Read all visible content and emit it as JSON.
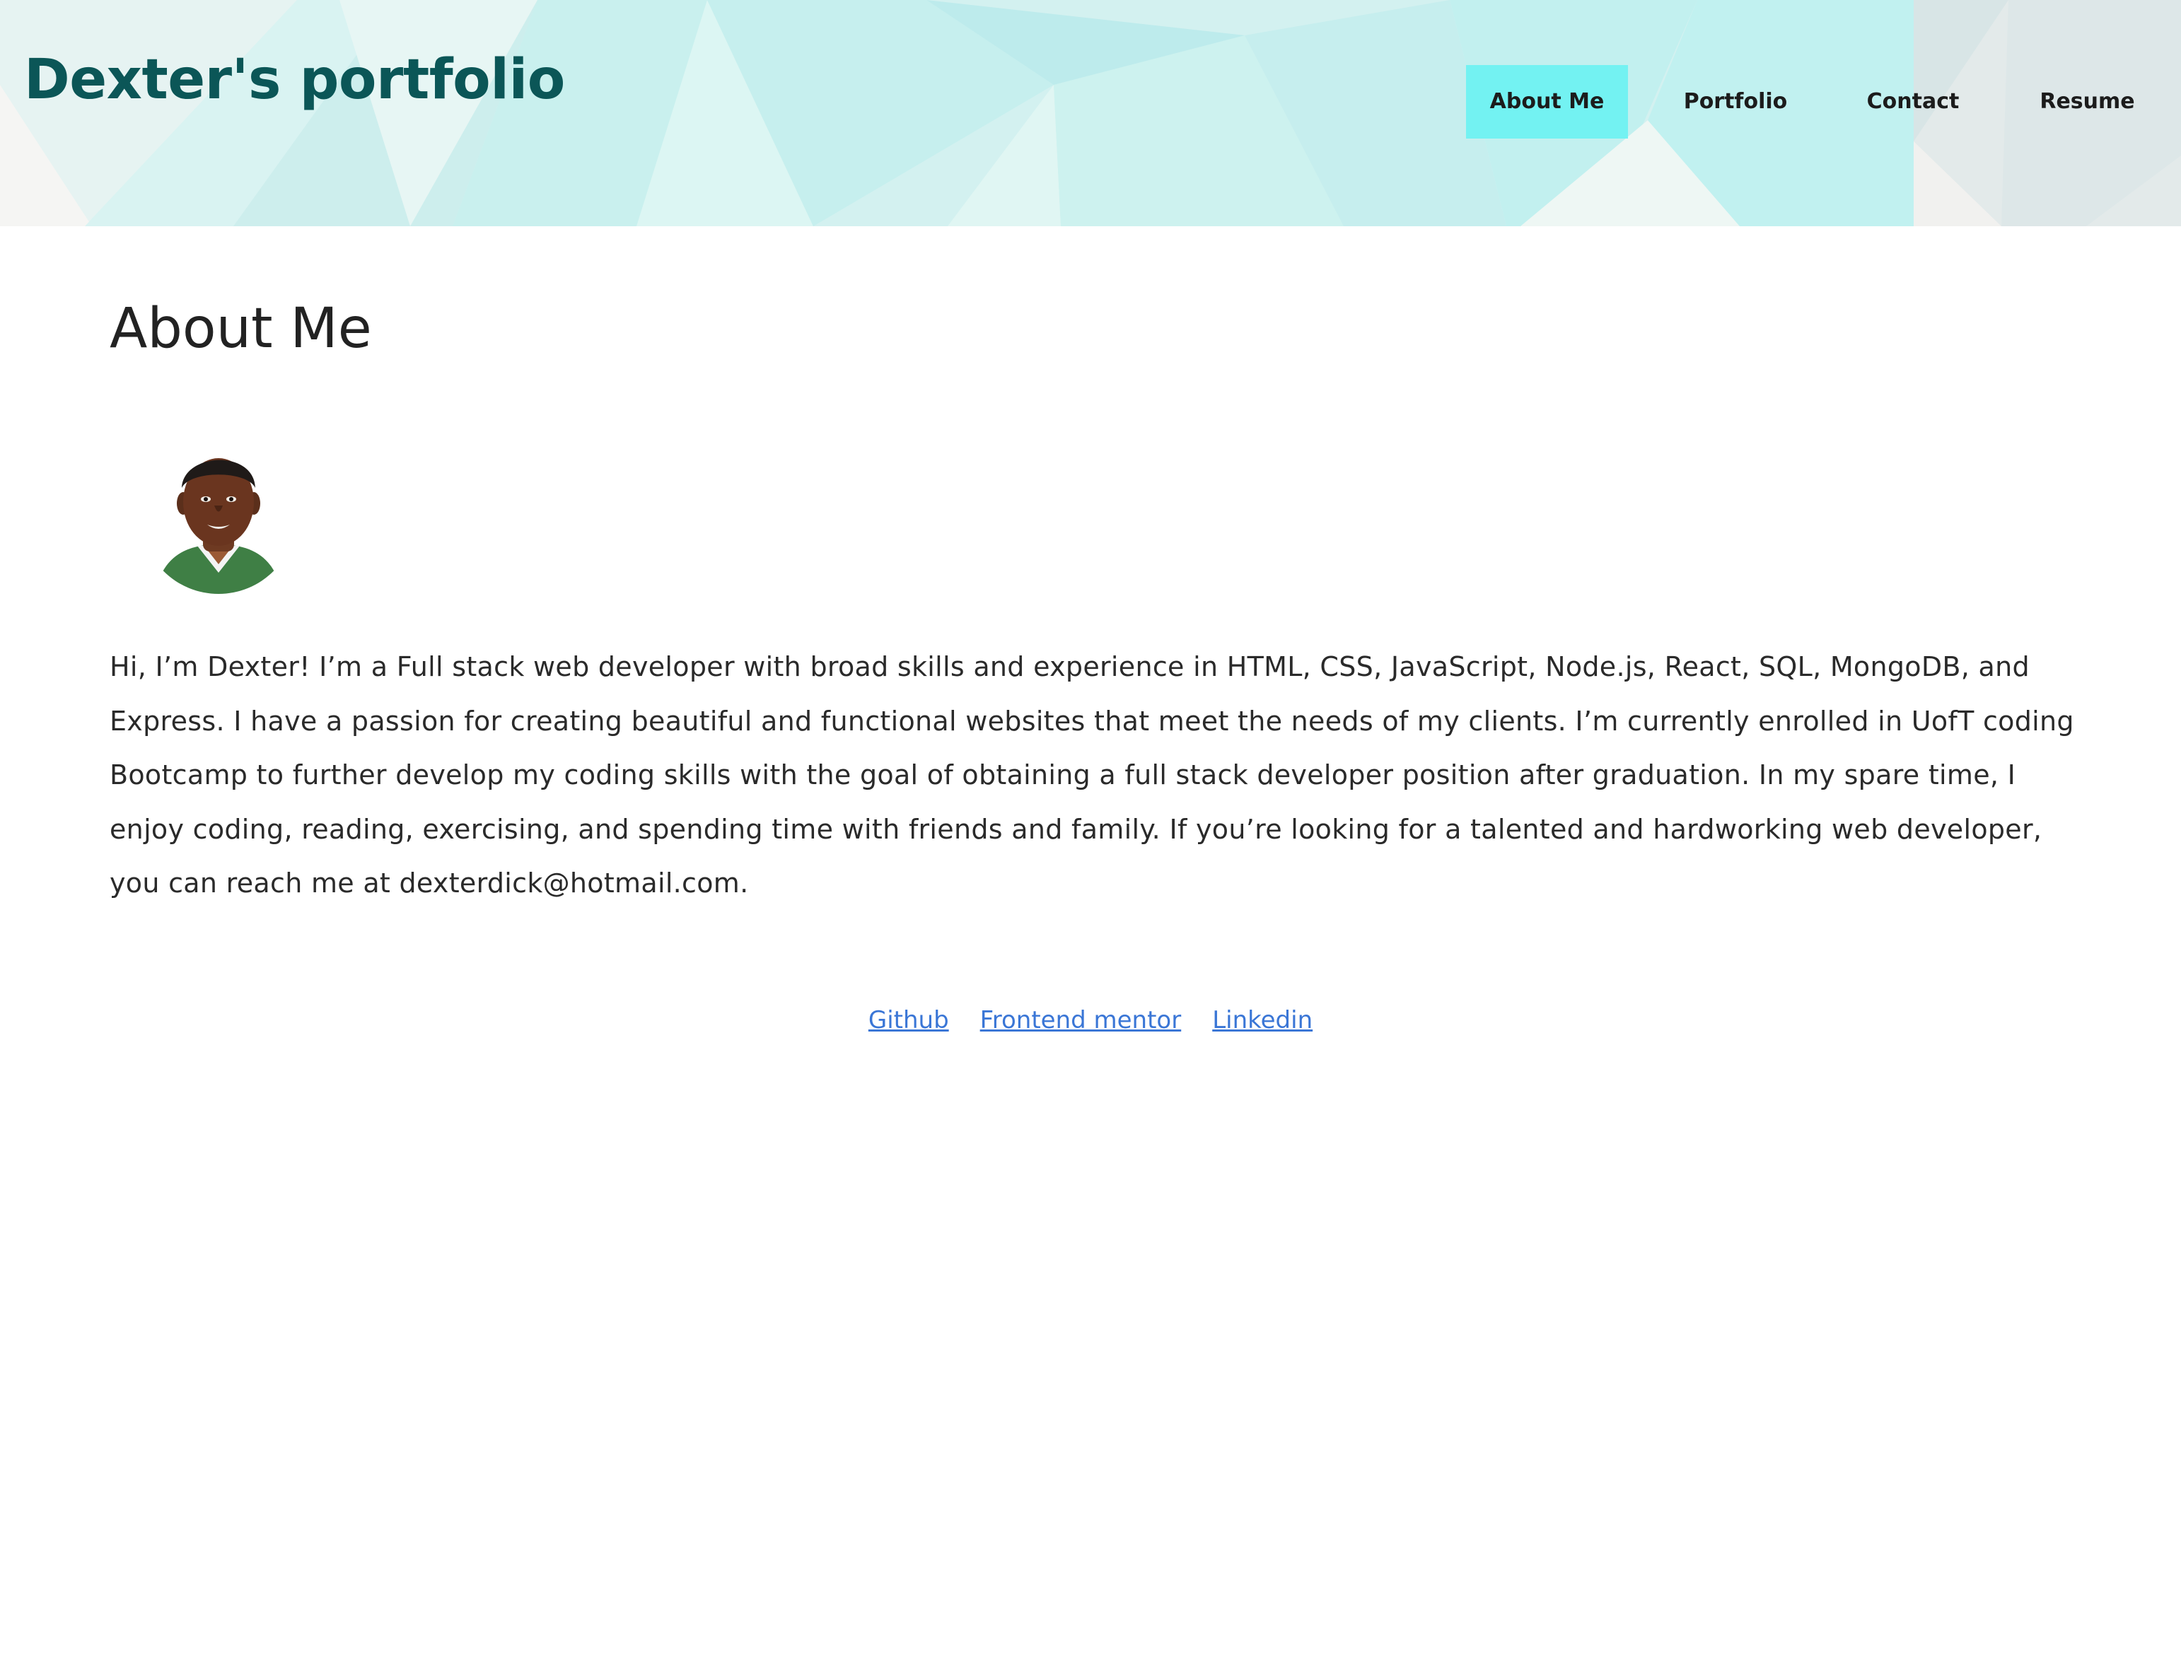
{
  "header": {
    "site_title": "Dexter's portfolio",
    "nav": [
      {
        "label": "About Me",
        "active": true
      },
      {
        "label": "Portfolio",
        "active": false
      },
      {
        "label": "Contact",
        "active": false
      },
      {
        "label": "Resume",
        "active": false
      }
    ]
  },
  "main": {
    "heading": "About Me",
    "avatar_icon": "profile-photo",
    "bio": "Hi, I’m Dexter! I’m a Full stack web developer with broad skills and experience in HTML, CSS, JavaScript, Node.js, React, SQL, MongoDB, and Express. I have a passion for creating beautiful and functional websites that meet the needs of my clients. I’m currently enrolled in UofT coding Bootcamp to further develop my coding skills with the goal of obtaining a full stack developer position after graduation. In my spare time, I enjoy coding, reading, exercising, and spending time with friends and family. If you’re looking for a talented and hardworking web developer, you can reach me at dexterdick@hotmail.com."
  },
  "footer": {
    "links": [
      "Github",
      "Frontend mentor",
      "Linkedin"
    ]
  },
  "colors": {
    "title": "#0b5657",
    "nav_active_bg": "#73f2f2",
    "link": "#3a76d6",
    "header_bg": "#d6f2f1"
  }
}
